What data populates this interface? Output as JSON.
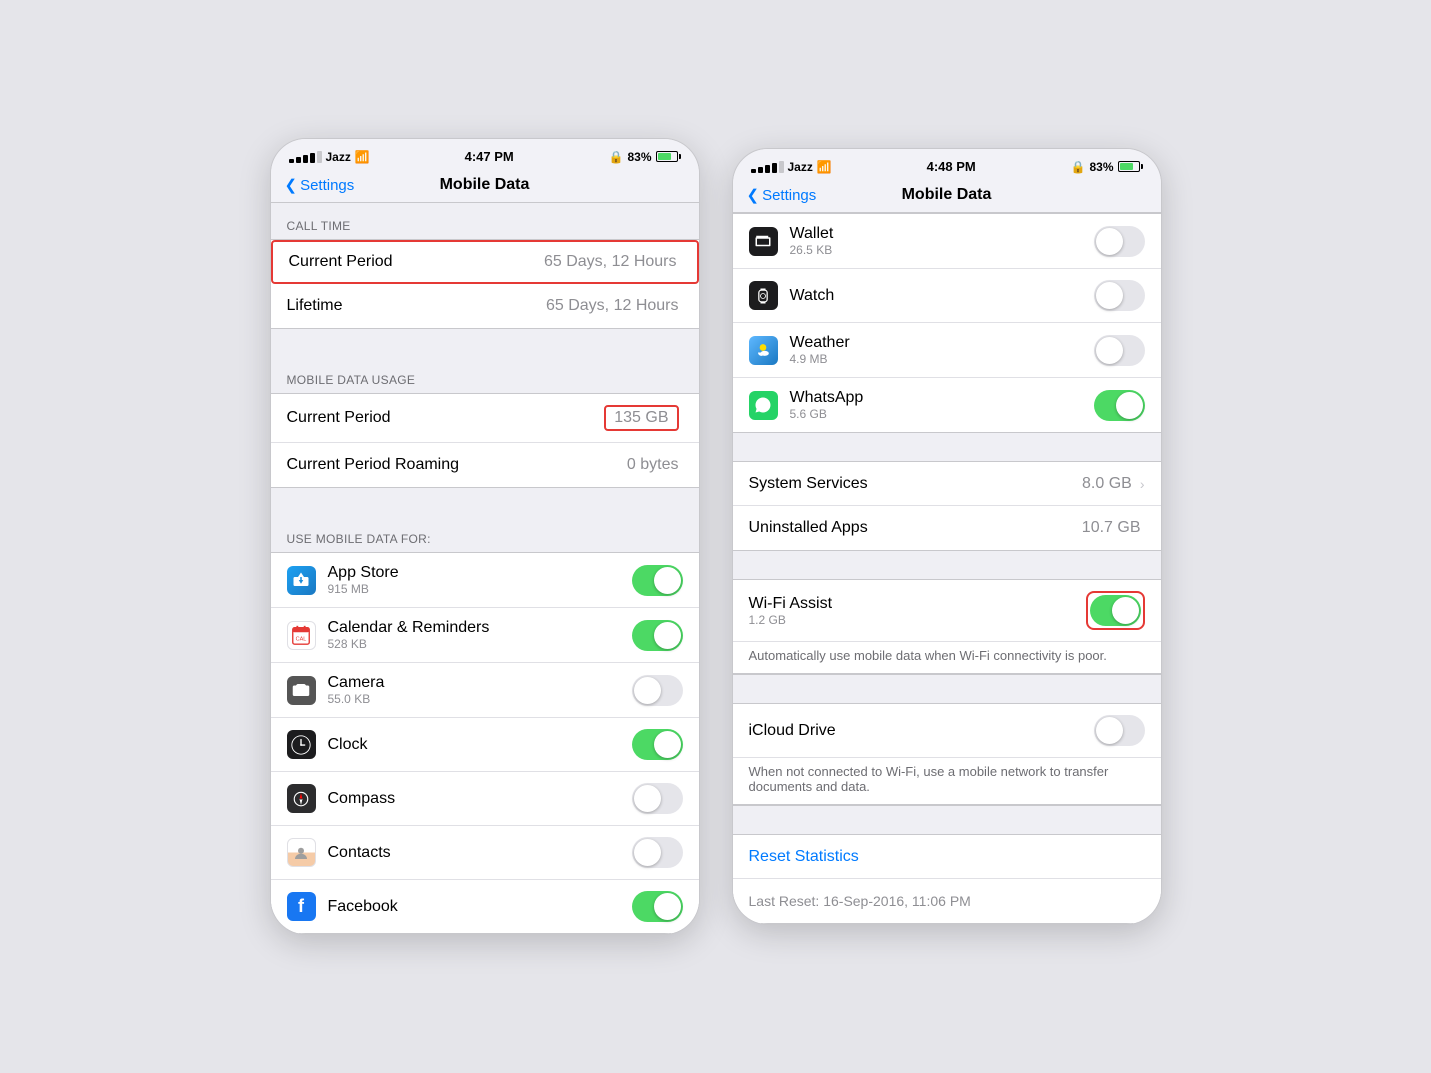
{
  "phone1": {
    "statusBar": {
      "carrier": "Jazz",
      "time": "4:47 PM",
      "battery": "83%"
    },
    "nav": {
      "backLabel": "Settings",
      "title": "Mobile Data"
    },
    "callTimeSection": {
      "header": "CALL TIME",
      "items": [
        {
          "label": "Current Period",
          "value": "65 Days, 12 Hours",
          "highlight": true
        },
        {
          "label": "Lifetime",
          "value": "65 Days, 12 Hours",
          "highlight": false
        }
      ]
    },
    "mobileDataSection": {
      "header": "MOBILE DATA USAGE",
      "items": [
        {
          "label": "Current Period",
          "value": "135 GB",
          "highlight": true
        },
        {
          "label": "Current Period Roaming",
          "value": "0 bytes",
          "highlight": false
        }
      ]
    },
    "appsSection": {
      "header": "USE MOBILE DATA FOR:",
      "apps": [
        {
          "name": "App Store",
          "size": "915 MB",
          "on": true,
          "color": "#1da1f2",
          "icon": "A"
        },
        {
          "name": "Calendar & Reminders",
          "size": "528 KB",
          "on": true,
          "color": "#e53935",
          "icon": "📅"
        },
        {
          "name": "Camera",
          "size": "55.0 KB",
          "on": false,
          "color": "#555",
          "icon": "📷"
        },
        {
          "name": "Clock",
          "size": "",
          "on": true,
          "color": "#1c1c1e",
          "icon": "⏰"
        },
        {
          "name": "Compass",
          "size": "",
          "on": false,
          "color": "#2c2c2e",
          "icon": "🧭"
        },
        {
          "name": "Contacts",
          "size": "",
          "on": false,
          "color": "#7c7c7c",
          "icon": "👤"
        },
        {
          "name": "Facebook",
          "size": "",
          "on": true,
          "color": "#1877f2",
          "icon": "f"
        }
      ]
    }
  },
  "phone2": {
    "statusBar": {
      "carrier": "Jazz",
      "time": "4:48 PM",
      "battery": "83%"
    },
    "nav": {
      "backLabel": "Settings",
      "title": "Mobile Data"
    },
    "apps": [
      {
        "name": "Wallet",
        "size": "26.5 KB",
        "on": false,
        "color": "#1c1c1e",
        "icon": "💳"
      },
      {
        "name": "Watch",
        "size": "",
        "on": false,
        "color": "#1c1c1e",
        "icon": "⌚"
      },
      {
        "name": "Weather",
        "size": "4.9 MB",
        "on": false,
        "color": "#1a78c2",
        "icon": "🌤"
      },
      {
        "name": "WhatsApp",
        "size": "5.6 GB",
        "on": true,
        "color": "#25d366",
        "icon": "W"
      }
    ],
    "systemServices": {
      "label": "System Services",
      "value": "8.0 GB"
    },
    "uninstalledApps": {
      "label": "Uninstalled Apps",
      "value": "10.7 GB"
    },
    "wifiAssist": {
      "label": "Wi-Fi Assist",
      "size": "1.2 GB",
      "on": true,
      "description": "Automatically use mobile data when Wi-Fi connectivity is poor.",
      "highlight": true
    },
    "icloudDrive": {
      "label": "iCloud Drive",
      "on": false,
      "description": "When not connected to Wi-Fi, use a mobile network to transfer documents and data."
    },
    "resetStatistics": {
      "label": "Reset Statistics"
    },
    "lastReset": {
      "label": "Last Reset: 16-Sep-2016, 11:06 PM"
    }
  }
}
